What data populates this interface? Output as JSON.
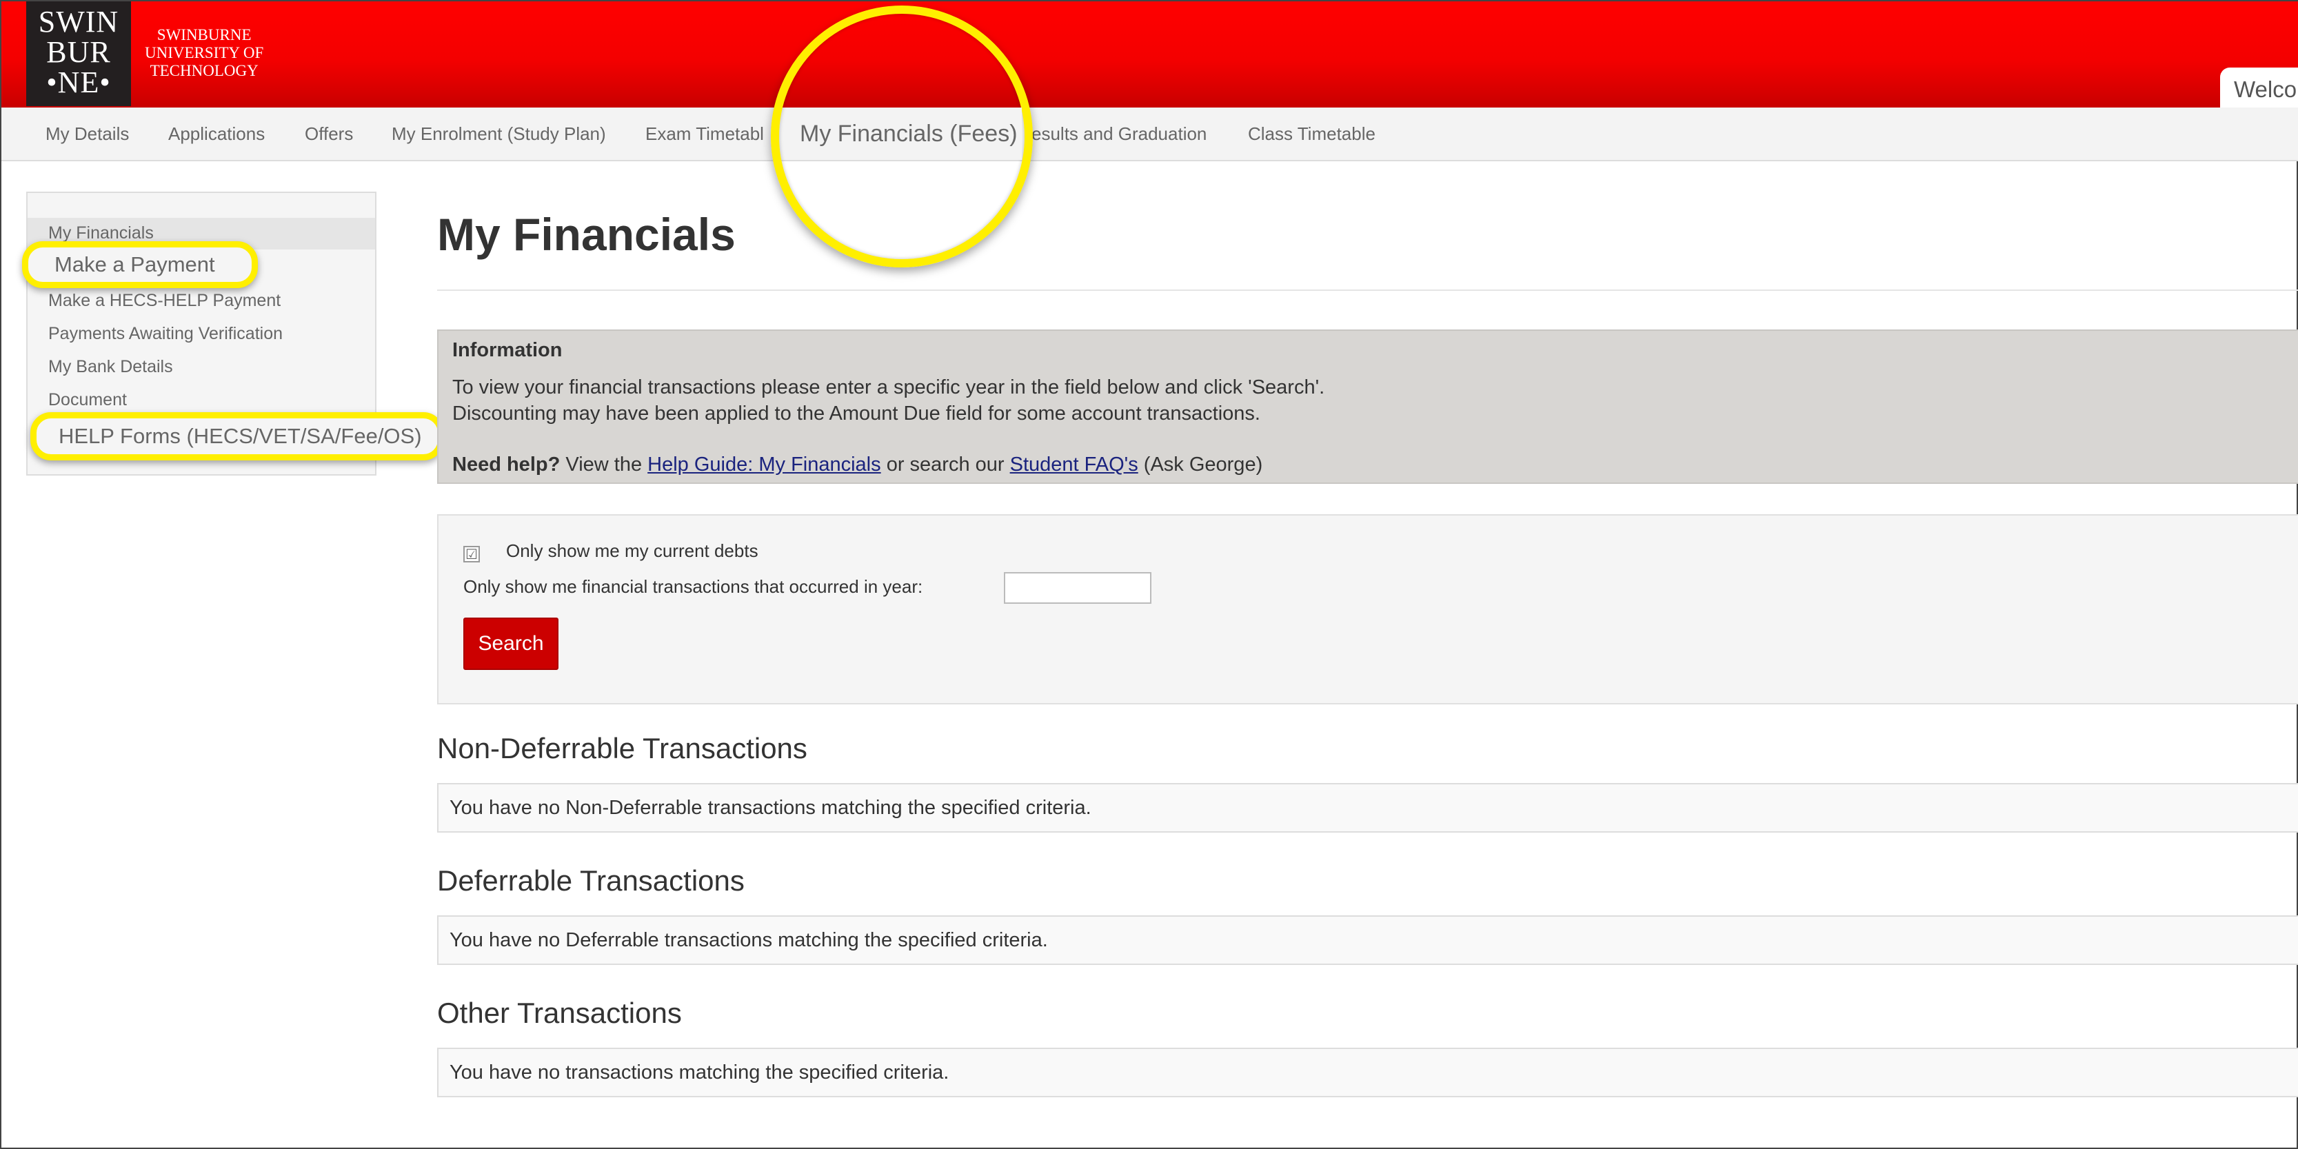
{
  "header": {
    "logo_lines": [
      "SWIN",
      "BUR",
      "•NE•"
    ],
    "university_lines": [
      "SWINBURNE",
      "UNIVERSITY OF",
      "TECHNOLOGY"
    ],
    "welcome_text": "Welco"
  },
  "nav": {
    "items": [
      "My Details",
      "Applications",
      "Offers",
      "My Enrolment (Study Plan)",
      "Exam Timetable",
      "My Financials (Fees)",
      "Results and Graduation",
      "Class Timetable"
    ],
    "items_visible": [
      "My Details",
      "Applications",
      "Offers",
      "My Enrolment (Study Plan)",
      "Exam Timetabl",
      "My Financials (Fees)",
      "esults and Graduation",
      "Class Timetable"
    ],
    "active": "My Financials (Fees)"
  },
  "sidebar": {
    "items": [
      "My Financials",
      "Make a Payment",
      "Make a HECS-HELP Payment",
      "Payments Awaiting Verification",
      "My Bank Details",
      "Document",
      "HELP Forms (HECS/VET/SA/Fee/OS)"
    ]
  },
  "main": {
    "title": "My Financials",
    "info": {
      "heading": "Information",
      "line1": "To view your financial transactions please enter a specific year in the field below and click 'Search'.",
      "line2": "Discounting may have been applied to the Amount Due field for some account transactions.",
      "need_help": "Need help?",
      "view_the": "View the",
      "help_link": "Help Guide: My Financials",
      "or_search": "or search our",
      "faq_link": "Student FAQ's",
      "ask": "(Ask George)"
    },
    "filter": {
      "current_debts_label": "Only show me my current debts",
      "current_debts_checked": true,
      "year_label": "Only show me financial transactions that occurred in year:",
      "year_value": "",
      "search_label": "Search"
    },
    "sections": [
      {
        "title": "Non-Deferrable Transactions",
        "message": "You have no Non-Deferrable transactions matching the specified criteria."
      },
      {
        "title": "Deferrable Transactions",
        "message": "You have no Deferrable transactions matching the specified criteria."
      },
      {
        "title": "Other Transactions",
        "message": "You have no transactions matching the specified criteria."
      }
    ]
  },
  "colors": {
    "header_red": "#ff0000",
    "button_red": "#cc0000",
    "highlight_yellow": "#ffef00",
    "info_bg": "#d8d6d3",
    "link": "#1a237e"
  }
}
